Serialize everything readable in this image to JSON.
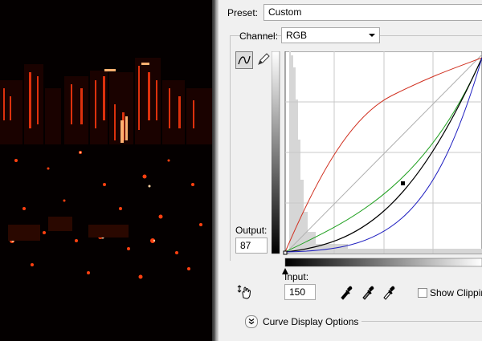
{
  "preset": {
    "label": "Preset:",
    "value": "Custom"
  },
  "channel": {
    "label": "Channel:",
    "value": "RGB"
  },
  "output": {
    "label": "Output:",
    "value": "87"
  },
  "input": {
    "label": "Input:",
    "value": "150"
  },
  "show_clipping": {
    "label": "Show Clipping"
  },
  "curve_display_options": {
    "label": "Curve Display Options"
  },
  "icons": [
    "curve-point-tool-icon",
    "pencil-tool-icon",
    "hand-adjust-icon",
    "black-eyedropper-icon",
    "gray-eyedropper-icon",
    "white-eyedropper-icon",
    "expand-chevrons-icon",
    "black-point-slider-icon"
  ],
  "colors": {
    "red_curve": "#d03020",
    "green_curve": "#20a020",
    "blue_curve": "#2020c0",
    "black_curve": "#000000",
    "panel_bg": "#f0f0f0"
  }
}
